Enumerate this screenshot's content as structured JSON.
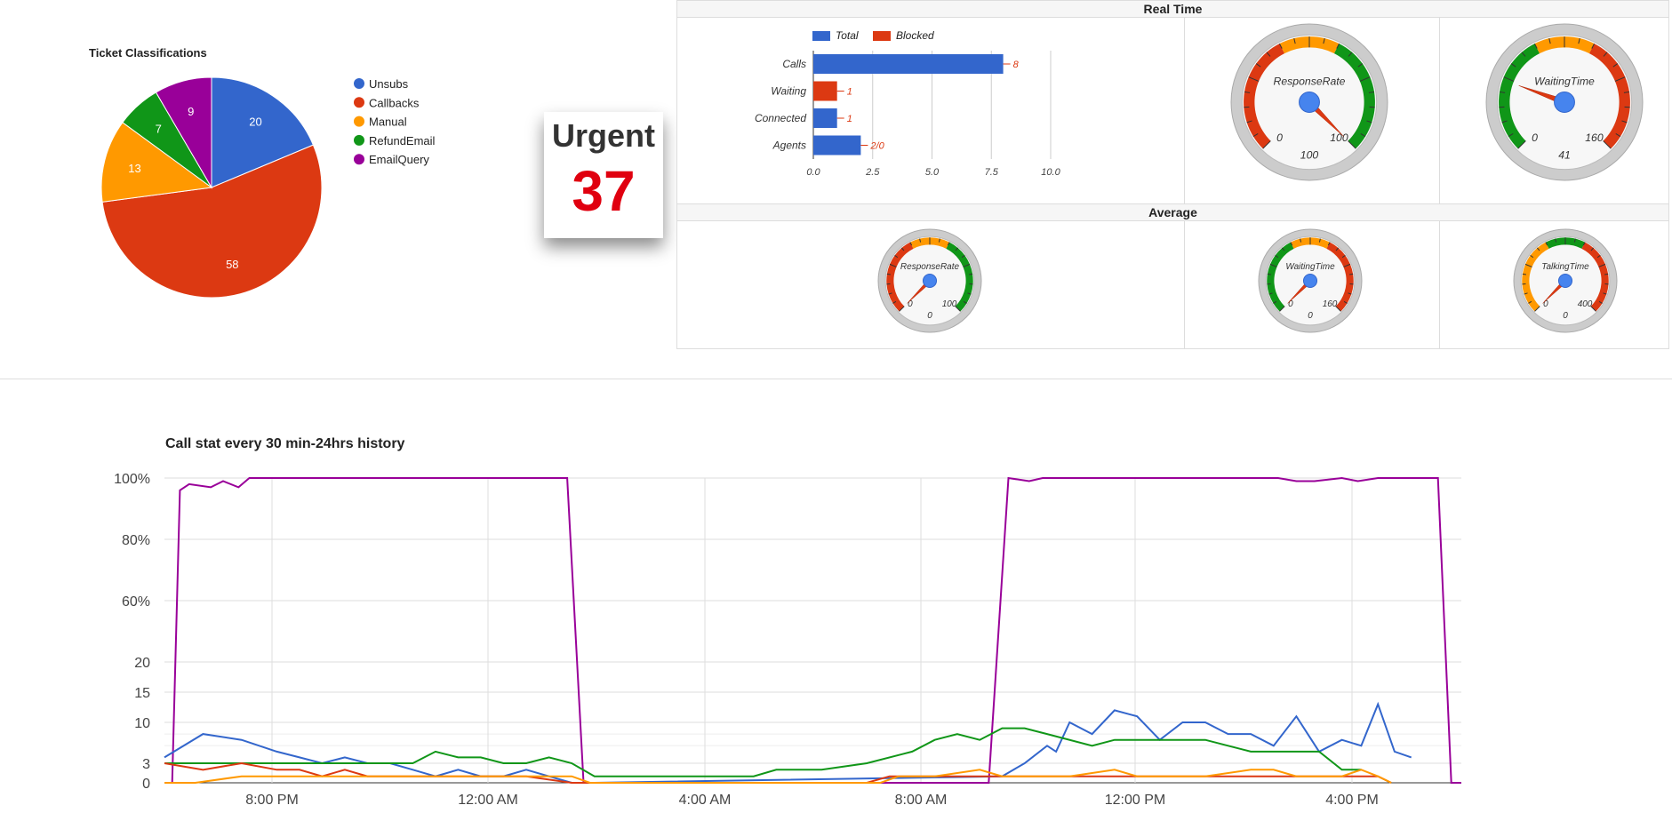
{
  "pie": {
    "title": "Ticket Classifications",
    "slices": [
      {
        "label": "Unsubs",
        "value": 20,
        "color": "#3366cc"
      },
      {
        "label": "Callbacks",
        "value": 58,
        "color": "#dc3912"
      },
      {
        "label": "Manual",
        "value": 13,
        "color": "#ff9900"
      },
      {
        "label": "RefundEmail",
        "value": 7,
        "color": "#109618"
      },
      {
        "label": "EmailQuery",
        "value": 9,
        "color": "#990099"
      }
    ]
  },
  "urgent": {
    "label": "Urgent",
    "value": "37",
    "color": "#e0000f"
  },
  "realtime": {
    "title": "Real Time",
    "average_title": "Average",
    "bar": {
      "legend": [
        "Total",
        "Blocked"
      ],
      "colors": [
        "#3366cc",
        "#dc3912"
      ],
      "categories": [
        "Calls",
        "Waiting",
        "Connected",
        "Agents"
      ],
      "values": [
        8,
        1,
        1,
        2
      ],
      "bar_colors": [
        "#3366cc",
        "#dc3912",
        "#3366cc",
        "#3366cc"
      ],
      "annotations": [
        "8",
        "1",
        "1",
        "2/0"
      ],
      "xticks": [
        "0.0",
        "2.5",
        "5.0",
        "7.5",
        "10.0"
      ],
      "xlim": [
        0,
        10
      ]
    },
    "gauges": [
      {
        "label": "ResponseRate",
        "min": "0",
        "max": "100",
        "value": "100"
      },
      {
        "label": "WaitingTime",
        "min": "0",
        "max": "160",
        "value": "41"
      }
    ],
    "avg_gauges": [
      {
        "label": "ResponseRate",
        "min": "0",
        "max": "100",
        "value": "0"
      },
      {
        "label": "WaitingTime",
        "min": "0",
        "max": "160",
        "value": "0"
      },
      {
        "label": "TalkingTime",
        "min": "0",
        "max": "400",
        "value": "0"
      }
    ]
  },
  "chart_data": {
    "type": "line",
    "title": "Call stat every 30 min-24hrs history",
    "yticks": [
      "0",
      "3",
      "10",
      "15",
      "20",
      "60%",
      "80%",
      "100%"
    ],
    "xticks": [
      "8:00 PM",
      "12:00 AM",
      "4:00 AM",
      "8:00 AM",
      "12:00 PM",
      "4:00 PM"
    ],
    "x_range": [
      "6:00 PM",
      "5:55 PM"
    ],
    "series": [
      {
        "color": "#990099",
        "values": [
          [
            0,
            0
          ],
          [
            0.05,
            0
          ],
          [
            0.1,
            96
          ],
          [
            0.16,
            98
          ],
          [
            0.3,
            97
          ],
          [
            0.38,
            99
          ],
          [
            0.48,
            97
          ],
          [
            0.55,
            100
          ],
          [
            1,
            100
          ],
          [
            3.95,
            100
          ],
          [
            4.13,
            0
          ],
          [
            8.6,
            0
          ],
          [
            8.82,
            100
          ],
          [
            9.05,
            99
          ],
          [
            9.2,
            100
          ],
          [
            11.8,
            100
          ],
          [
            12.0,
            99
          ],
          [
            12.2,
            99
          ],
          [
            12.5,
            100
          ],
          [
            12.7,
            99
          ],
          [
            13.0,
            100
          ],
          [
            13.9,
            100
          ],
          [
            14.1,
            0
          ],
          [
            14.25,
            0
          ]
        ]
      },
      {
        "color": "#3366cc",
        "values": [
          [
            0,
            4
          ],
          [
            0.25,
            8
          ],
          [
            0.5,
            7
          ],
          [
            0.75,
            5
          ],
          [
            1,
            4
          ],
          [
            1.25,
            3
          ],
          [
            1.5,
            4
          ],
          [
            1.75,
            3
          ],
          [
            2,
            3
          ],
          [
            2.25,
            2
          ],
          [
            2.5,
            1
          ],
          [
            2.75,
            2
          ],
          [
            3,
            1
          ],
          [
            3.25,
            1
          ],
          [
            3.5,
            2
          ],
          [
            3.75,
            1
          ],
          [
            4,
            0
          ],
          [
            4.25,
            0
          ],
          [
            8.75,
            1
          ],
          [
            9,
            3
          ],
          [
            9.25,
            6
          ],
          [
            9.35,
            5
          ],
          [
            9.5,
            10
          ],
          [
            9.75,
            8
          ],
          [
            10,
            12
          ],
          [
            10.25,
            11
          ],
          [
            10.5,
            7
          ],
          [
            10.75,
            10
          ],
          [
            11,
            10
          ],
          [
            11.25,
            8
          ],
          [
            11.5,
            8
          ],
          [
            11.75,
            6
          ],
          [
            12,
            11
          ],
          [
            12.25,
            5
          ],
          [
            12.5,
            7
          ],
          [
            12.75,
            6
          ],
          [
            13,
            13
          ],
          [
            13.25,
            5
          ],
          [
            13.5,
            4
          ]
        ]
      },
      {
        "color": "#109618",
        "values": [
          [
            0,
            3
          ],
          [
            0.25,
            3
          ],
          [
            0.5,
            3
          ],
          [
            1,
            3
          ],
          [
            1.5,
            3
          ],
          [
            2,
            3
          ],
          [
            2.25,
            3
          ],
          [
            2.5,
            5
          ],
          [
            2.75,
            4
          ],
          [
            3,
            4
          ],
          [
            3.25,
            3
          ],
          [
            3.5,
            3
          ],
          [
            3.75,
            4
          ],
          [
            4,
            3
          ],
          [
            4.25,
            1
          ],
          [
            6,
            1
          ],
          [
            6.25,
            2
          ],
          [
            6.75,
            2
          ],
          [
            7.25,
            3
          ],
          [
            7.75,
            5
          ],
          [
            8,
            7
          ],
          [
            8.25,
            8
          ],
          [
            8.5,
            7
          ],
          [
            8.75,
            9
          ],
          [
            9,
            9
          ],
          [
            9.25,
            8
          ],
          [
            9.75,
            6
          ],
          [
            10,
            7
          ],
          [
            10.5,
            7
          ],
          [
            11,
            7
          ],
          [
            11.25,
            6
          ],
          [
            11.5,
            5
          ],
          [
            12,
            5
          ],
          [
            12.25,
            5
          ],
          [
            12.5,
            2
          ],
          [
            12.75,
            2
          ]
        ]
      },
      {
        "color": "#dc3912",
        "values": [
          [
            0,
            3
          ],
          [
            0.25,
            2
          ],
          [
            0.5,
            3
          ],
          [
            0.75,
            2
          ],
          [
            1,
            2
          ],
          [
            1.25,
            1
          ],
          [
            1.5,
            2
          ],
          [
            1.75,
            1
          ],
          [
            2,
            1
          ],
          [
            2.5,
            1
          ],
          [
            3,
            1
          ],
          [
            3.5,
            1
          ],
          [
            4,
            0
          ],
          [
            4.25,
            0
          ],
          [
            7.25,
            0
          ],
          [
            7.5,
            1
          ],
          [
            8,
            1
          ],
          [
            10,
            1
          ],
          [
            10.5,
            1
          ],
          [
            11,
            1
          ],
          [
            11.5,
            1
          ],
          [
            12,
            1
          ],
          [
            12.5,
            1
          ],
          [
            13,
            1
          ],
          [
            13.2,
            0
          ]
        ]
      },
      {
        "color": "#ff9900",
        "values": [
          [
            0,
            0
          ],
          [
            0.2,
            0
          ],
          [
            0.5,
            1
          ],
          [
            1,
            1
          ],
          [
            2,
            1
          ],
          [
            3,
            1
          ],
          [
            4,
            1
          ],
          [
            4.2,
            0
          ],
          [
            7.4,
            0
          ],
          [
            7.6,
            1
          ],
          [
            8.0,
            1
          ],
          [
            8.5,
            2
          ],
          [
            8.75,
            1
          ],
          [
            9.5,
            1
          ],
          [
            10,
            2
          ],
          [
            10.25,
            1
          ],
          [
            11,
            1
          ],
          [
            11.5,
            2
          ],
          [
            11.75,
            2
          ],
          [
            12,
            1
          ],
          [
            12.5,
            1
          ],
          [
            12.75,
            2
          ],
          [
            13,
            1
          ],
          [
            13.2,
            0
          ]
        ]
      }
    ]
  }
}
